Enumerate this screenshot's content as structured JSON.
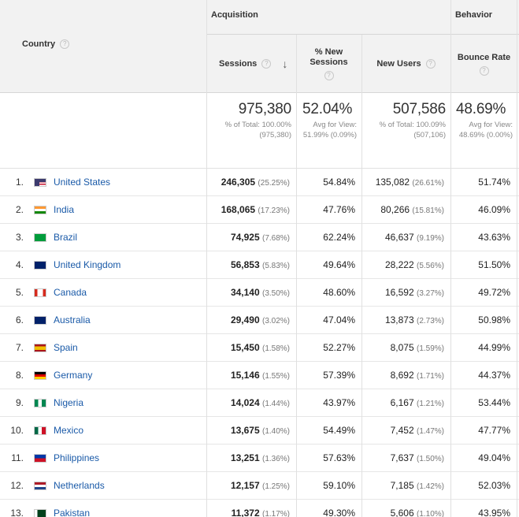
{
  "header": {
    "country_label": "Country",
    "groups": {
      "acquisition": "Acquisition",
      "behavior": "Behavior"
    },
    "columns": {
      "sessions": "Sessions",
      "new_sessions": "% New Sessions",
      "new_users": "New Users",
      "bounce_rate": "Bounce Rate"
    },
    "help_glyph": "?",
    "sort_glyph": "↓"
  },
  "totals": {
    "sessions": "975,380",
    "sessions_sub": "% of Total: 100.00% (975,380)",
    "new_sessions": "52.04%",
    "new_sessions_sub": "Avg for View: 51.99% (0.09%)",
    "new_users": "507,586",
    "new_users_sub": "% of Total: 100.09% (507,106)",
    "bounce_rate": "48.69%",
    "bounce_rate_sub": "Avg for View: 48.69% (0.00%)"
  },
  "rows": [
    {
      "rank": "1.",
      "country": "United States",
      "flag": "us",
      "sessions": "246,305",
      "sessions_pct": "(25.25%)",
      "new_sessions": "54.84%",
      "new_users": "135,082",
      "new_users_pct": "(26.61%)",
      "bounce_rate": "51.74%"
    },
    {
      "rank": "2.",
      "country": "India",
      "flag": "in",
      "sessions": "168,065",
      "sessions_pct": "(17.23%)",
      "new_sessions": "47.76%",
      "new_users": "80,266",
      "new_users_pct": "(15.81%)",
      "bounce_rate": "46.09%"
    },
    {
      "rank": "3.",
      "country": "Brazil",
      "flag": "br",
      "sessions": "74,925",
      "sessions_pct": "(7.68%)",
      "new_sessions": "62.24%",
      "new_users": "46,637",
      "new_users_pct": "(9.19%)",
      "bounce_rate": "43.63%"
    },
    {
      "rank": "4.",
      "country": "United Kingdom",
      "flag": "gb",
      "sessions": "56,853",
      "sessions_pct": "(5.83%)",
      "new_sessions": "49.64%",
      "new_users": "28,222",
      "new_users_pct": "(5.56%)",
      "bounce_rate": "51.50%"
    },
    {
      "rank": "5.",
      "country": "Canada",
      "flag": "ca",
      "sessions": "34,140",
      "sessions_pct": "(3.50%)",
      "new_sessions": "48.60%",
      "new_users": "16,592",
      "new_users_pct": "(3.27%)",
      "bounce_rate": "49.72%"
    },
    {
      "rank": "6.",
      "country": "Australia",
      "flag": "au",
      "sessions": "29,490",
      "sessions_pct": "(3.02%)",
      "new_sessions": "47.04%",
      "new_users": "13,873",
      "new_users_pct": "(2.73%)",
      "bounce_rate": "50.98%"
    },
    {
      "rank": "7.",
      "country": "Spain",
      "flag": "es",
      "sessions": "15,450",
      "sessions_pct": "(1.58%)",
      "new_sessions": "52.27%",
      "new_users": "8,075",
      "new_users_pct": "(1.59%)",
      "bounce_rate": "44.99%"
    },
    {
      "rank": "8.",
      "country": "Germany",
      "flag": "de",
      "sessions": "15,146",
      "sessions_pct": "(1.55%)",
      "new_sessions": "57.39%",
      "new_users": "8,692",
      "new_users_pct": "(1.71%)",
      "bounce_rate": "44.37%"
    },
    {
      "rank": "9.",
      "country": "Nigeria",
      "flag": "ng",
      "sessions": "14,024",
      "sessions_pct": "(1.44%)",
      "new_sessions": "43.97%",
      "new_users": "6,167",
      "new_users_pct": "(1.21%)",
      "bounce_rate": "53.44%"
    },
    {
      "rank": "10.",
      "country": "Mexico",
      "flag": "mx",
      "sessions": "13,675",
      "sessions_pct": "(1.40%)",
      "new_sessions": "54.49%",
      "new_users": "7,452",
      "new_users_pct": "(1.47%)",
      "bounce_rate": "47.77%"
    },
    {
      "rank": "11.",
      "country": "Philippines",
      "flag": "ph",
      "sessions": "13,251",
      "sessions_pct": "(1.36%)",
      "new_sessions": "57.63%",
      "new_users": "7,637",
      "new_users_pct": "(1.50%)",
      "bounce_rate": "49.04%"
    },
    {
      "rank": "12.",
      "country": "Netherlands",
      "flag": "nl",
      "sessions": "12,157",
      "sessions_pct": "(1.25%)",
      "new_sessions": "59.10%",
      "new_users": "7,185",
      "new_users_pct": "(1.42%)",
      "bounce_rate": "52.03%"
    },
    {
      "rank": "13.",
      "country": "Pakistan",
      "flag": "pk",
      "sessions": "11,372",
      "sessions_pct": "(1.17%)",
      "new_sessions": "49.30%",
      "new_users": "5,606",
      "new_users_pct": "(1.10%)",
      "bounce_rate": "43.95%"
    }
  ],
  "colors": {
    "link": "#1a5aa8",
    "header_bg": "#f2f2f2",
    "muted": "#888888"
  }
}
